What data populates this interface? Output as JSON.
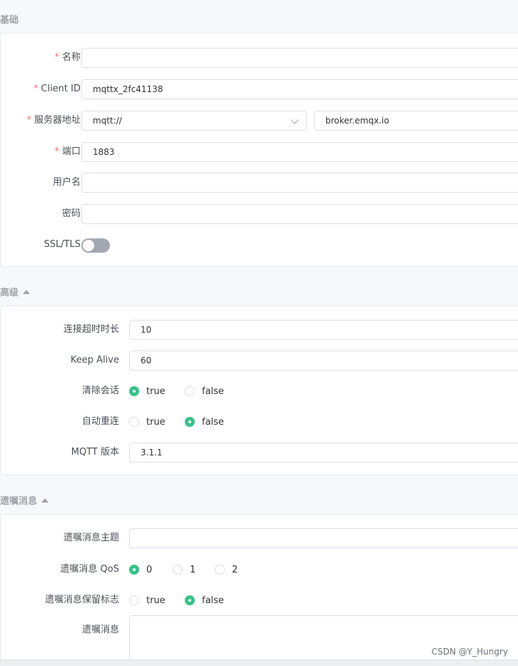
{
  "basic": {
    "title": "基础",
    "name": {
      "label": "名称",
      "value": ""
    },
    "client_id": {
      "label": "Client ID",
      "value": "mqttx_2fc41138"
    },
    "host": {
      "label": "服务器地址",
      "protocol": "mqtt://",
      "value": "broker.emqx.io"
    },
    "port": {
      "label": "端口",
      "value": "1883"
    },
    "username": {
      "label": "用户名",
      "value": ""
    },
    "password": {
      "label": "密码",
      "value": ""
    },
    "ssl": {
      "label": "SSL/TLS",
      "enabled": false
    }
  },
  "advanced": {
    "title": "高级",
    "connect_timeout": {
      "label": "连接超时时长",
      "value": "10"
    },
    "keep_alive": {
      "label": "Keep Alive",
      "value": "60"
    },
    "clean_session": {
      "label": "清除会话",
      "options": [
        "true",
        "false"
      ],
      "selected": "true"
    },
    "auto_reconnect": {
      "label": "自动重连",
      "options": [
        "true",
        "false"
      ],
      "selected": "false"
    },
    "mqtt_version": {
      "label": "MQTT 版本",
      "value": "3.1.1"
    }
  },
  "will": {
    "title": "遗嘱消息",
    "topic": {
      "label": "遗嘱消息主题",
      "value": ""
    },
    "qos": {
      "label": "遗嘱消息 QoS",
      "options": [
        "0",
        "1",
        "2"
      ],
      "selected": "0"
    },
    "retain": {
      "label": "遗嘱消息保留标志",
      "options": [
        "true",
        "false"
      ],
      "selected": "false"
    },
    "payload": {
      "label": "遗嘱消息",
      "value": ""
    }
  },
  "required_mark": "*",
  "watermark": "CSDN @Y_Hungry",
  "colors": {
    "accent": "#34c388",
    "required": "#f56c6c",
    "section_title": "#a0a4ab"
  }
}
